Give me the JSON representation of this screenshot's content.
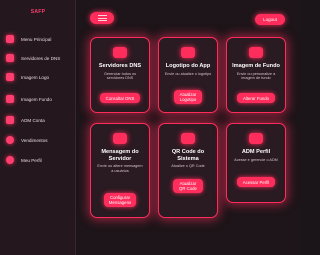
{
  "sidebar": {
    "brand": "SAFP",
    "items": [
      {
        "label": "Menu Principal",
        "icon": "home-icon"
      },
      {
        "label": "Servidores de DNS",
        "icon": "server-icon"
      },
      {
        "label": "Imagem Logo",
        "icon": "image-icon"
      },
      {
        "label": "Imagem Fundo",
        "icon": "image-icon"
      },
      {
        "label": "ADM Conta",
        "icon": "account-icon"
      },
      {
        "label": "Vendimentos",
        "icon": "users-icon"
      },
      {
        "label": "Meu Perfil",
        "icon": "user-icon"
      }
    ]
  },
  "header": {
    "logout_label": "Logout"
  },
  "cards": [
    {
      "title": "Servidores DNS",
      "desc": "Gerenciar todos os servidores DNS",
      "button": "Consultar DNS"
    },
    {
      "title": "Logotipo do App",
      "desc": "Envie ou atualize o logotipo",
      "button": "Atualizar Logotipo"
    },
    {
      "title": "Imagem de Fundo",
      "desc": "Envie ou personalize a imagem de fundo",
      "button": "Alterar Fundo"
    },
    {
      "title": "Mensagem do Servidor",
      "desc": "Envie ou altere mensagem a usuários",
      "button": "Configurar Mensagens"
    },
    {
      "title": "QR Code do Sistema",
      "desc": "Atualize o QR Code",
      "button": "Atualizar QR Code"
    },
    {
      "title": "ADM Perfil",
      "desc": "Acesse e gerencie o ADM",
      "button": "Acessar Perfil"
    }
  ],
  "colors": {
    "accent": "#ff2d5c",
    "background": "#1b1419",
    "sidebar": "#24181e",
    "card": "#2a1a21"
  }
}
